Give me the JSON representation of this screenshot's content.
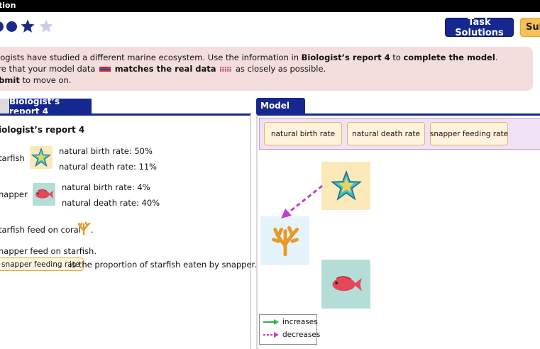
{
  "window": {
    "title": "tion"
  },
  "progress": {
    "filled_dots": 2,
    "stars_filled": 1,
    "stars_total": 2
  },
  "toolbar": {
    "solutions_label": "Task Solutions",
    "submit_label": "Submit"
  },
  "instructions": {
    "line1_pre": "ologists have studied a different marine ecosystem. Use the information in ",
    "line1_bold1": "Biologist’s report 4",
    "line1_mid": " to complete the model",
    "line1_end": ".",
    "line1_bold2": "complete the model",
    "line1_to": " to ",
    "line2_pre": "ure that your model data",
    "line2_bold": "matches the real data",
    "line2_post": "as closely as possible.",
    "line3_bold": "ubmit",
    "line3_post": " to move on."
  },
  "left": {
    "tab_label": "Biologist’s report 4",
    "heading": "iologist’s report 4",
    "starfish": {
      "name": "tarfish",
      "birth": "natural birth rate: 50%",
      "death": "natural death rate: 11%"
    },
    "snapper": {
      "name": "napper",
      "birth": "natural birth rate: 4%",
      "death": "natural death rate: 40%"
    },
    "coral_line": "tarfish feed on coral",
    "coral_period": ".",
    "snapper_feed_line": "napper feed on starfish.",
    "feeding_tag": "snapper feeding rate",
    "feeding_line_post": " is the proportion of starfish eaten by snapper."
  },
  "right": {
    "tab_label": "Model",
    "params": [
      "natural birth rate",
      "natural death rate",
      "snapper feeding rate"
    ],
    "legend": {
      "increases": "increases",
      "decreases": "decreases"
    }
  },
  "colors": {
    "accent_blue": "#15288f",
    "submit_orange": "#f7c157",
    "increase_green": "#2fb34a",
    "decrease_magenta": "#c23fd4",
    "instr_bg": "#f3dedb"
  },
  "icons": [
    "star-icon",
    "starfish-icon",
    "snapper-fish-icon",
    "coral-icon"
  ]
}
